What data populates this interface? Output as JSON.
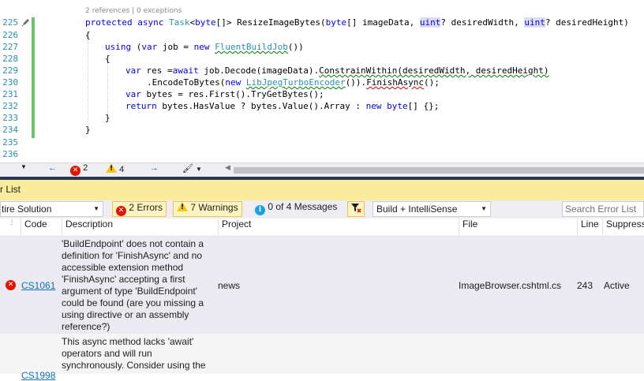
{
  "editor": {
    "line_numbers": [
      "225",
      "226",
      "227",
      "228",
      "229",
      "230",
      "231",
      "232",
      "233",
      "234",
      "235",
      "236"
    ],
    "codelens": "2 references | 0 exceptions",
    "code": {
      "l225_kw": "protected async ",
      "l225_ty": "Task",
      "l225_a": "<",
      "l225_kw2": "byte",
      "l225_b": "[]> ResizeImageBytes(",
      "l225_kw3": "byte",
      "l225_c": "[] imageData, ",
      "l225_kw4": "uint",
      "l225_d": "? desiredWidth, ",
      "l225_kw5": "uint",
      "l225_e": "? desiredHeight)",
      "l226": "{",
      "l227_kw": "using",
      "l227_a": " (",
      "l227_kw2": "var",
      "l227_b": " job = ",
      "l227_kw3": "new",
      "l227_sp": " ",
      "l227_ty": "FluentBuildJob",
      "l227_c": "())",
      "l228": "{",
      "l229_kw": "var",
      "l229_a": " res =",
      "l229_kw2": "await",
      "l229_b": " job.Decode(imageData).",
      "l229_sq": "ConstrainWithin(desiredWidth, desiredHeight)",
      "l230_a": ".EncodeToBytes(",
      "l230_kw": "new",
      "l230_sp": " ",
      "l230_ty": "LibJpegTurboEncoder",
      "l230_b": "()).",
      "l230_err": "FinishAsync",
      "l230_c": "();",
      "l231_kw": "var",
      "l231_a": " bytes = res.First().TryGetBytes();",
      "l232_kw": "return",
      "l232_a": " bytes.HasValue ? bytes.Value().Array : ",
      "l232_kw2": "new",
      "l232_sp": " ",
      "l232_kw3": "byte",
      "l232_b": "[] {};",
      "l233": "}",
      "l234": "}"
    },
    "status": {
      "errors": "2",
      "warnings": "4"
    }
  },
  "error_list": {
    "title": "r List",
    "scope": "tire Solution",
    "errors_filter": "2 Errors",
    "warnings_filter": "7 Warnings",
    "messages_filter": "0 of 4 Messages",
    "source": "Build + IntelliSense",
    "search_placeholder": "Search Error List",
    "columns": [
      "Code",
      "Description",
      "Project",
      "File",
      "Line",
      "Suppress"
    ],
    "rows": [
      {
        "code": "CS1061",
        "description": "'BuildEndpoint' does not contain a definition for 'FinishAsync' and no accessible extension method 'FinishAsync' accepting a first argument of type 'BuildEndpoint' could be found (are you missing a using directive or an assembly reference?)",
        "project": "news",
        "file": "ImageBrowser.cshtml.cs",
        "line": "243",
        "suppress": "Active"
      },
      {
        "code": "CS1998",
        "description": "This async method lacks 'await' operators and will run synchronously. Consider using the",
        "project": "",
        "file": "",
        "line": "",
        "suppress": ""
      }
    ]
  },
  "colors": {
    "keyword": "#0000ff",
    "type": "#2b91af",
    "title_bar": "#fbeb9c",
    "error": "#e51400",
    "warning": "#f2c811",
    "link": "#0e70c0"
  }
}
